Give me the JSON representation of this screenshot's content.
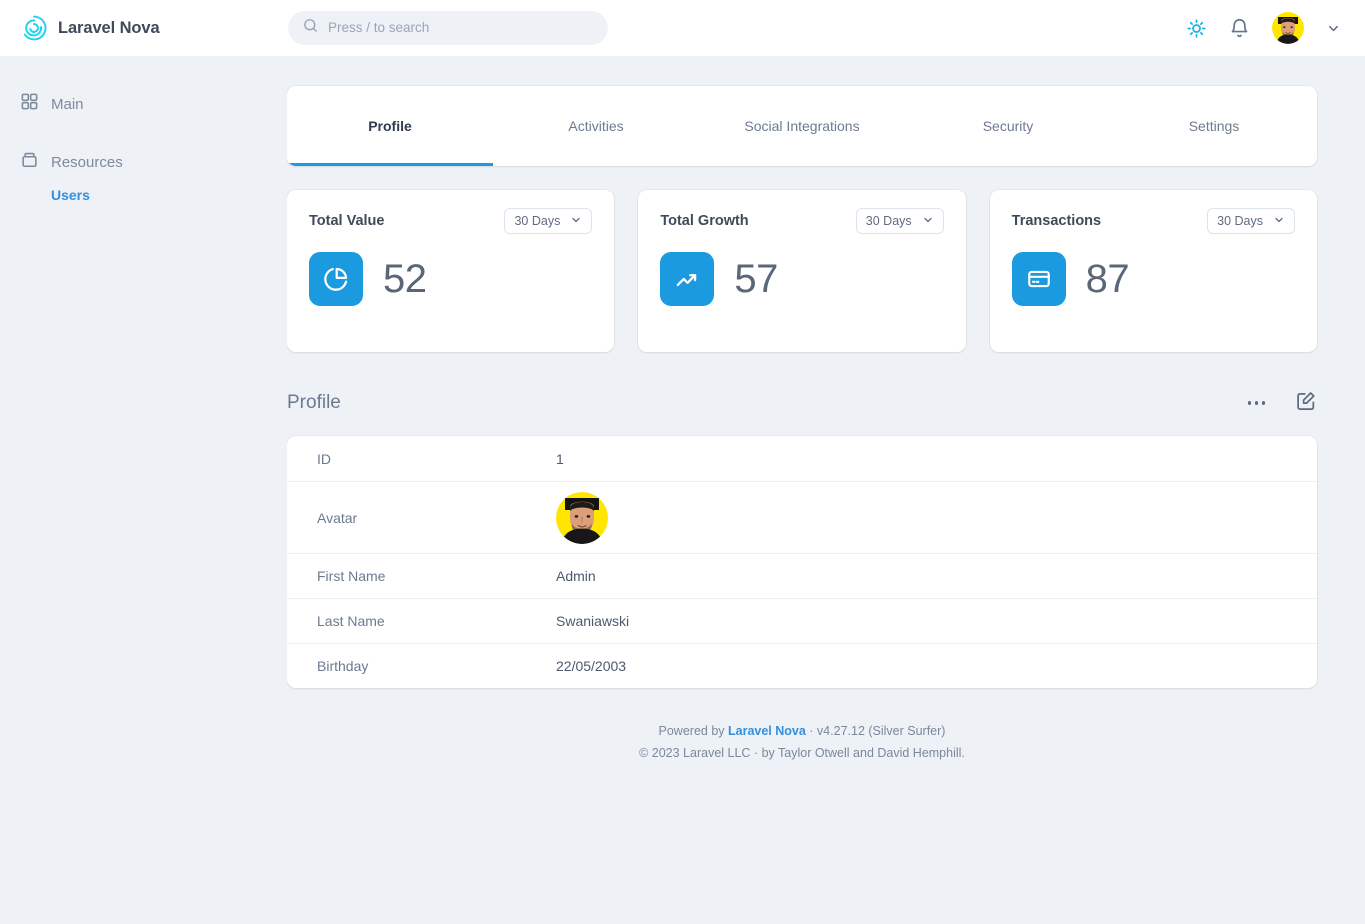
{
  "header": {
    "brand_name": "Laravel Nova",
    "logo_icon": "nova-spiral-logo",
    "search": {
      "placeholder": "Press / to search",
      "value": "",
      "icon": "search-icon"
    },
    "theme_toggle_icon": "sun-icon",
    "notifications_icon": "bell-icon",
    "avatar_icon": "user-avatar",
    "user_menu_icon": "chevron-down-icon"
  },
  "sidebar": {
    "groups": [
      {
        "label": "Main",
        "icon": "grid-icon",
        "items": []
      },
      {
        "label": "Resources",
        "icon": "archive-box-icon",
        "items": [
          {
            "label": "Users",
            "active": true
          }
        ]
      }
    ]
  },
  "tabs": [
    {
      "label": "Profile",
      "active": true
    },
    {
      "label": "Activities",
      "active": false
    },
    {
      "label": "Social Integrations",
      "active": false
    },
    {
      "label": "Security",
      "active": false
    },
    {
      "label": "Settings",
      "active": false
    }
  ],
  "metrics": [
    {
      "title": "Total Value",
      "value": "52",
      "range": "30 Days",
      "icon": "pie-chart-icon"
    },
    {
      "title": "Total Growth",
      "value": "57",
      "range": "30 Days",
      "icon": "trending-up-icon"
    },
    {
      "title": "Transactions",
      "value": "87",
      "range": "30 Days",
      "icon": "credit-card-icon"
    }
  ],
  "panel": {
    "title": "Profile",
    "more_icon": "ellipsis-icon",
    "edit_icon": "edit-pencil-square-icon",
    "rows": [
      {
        "label": "ID",
        "value": "1",
        "type": "text"
      },
      {
        "label": "Avatar",
        "value": "",
        "type": "image"
      },
      {
        "label": "First Name",
        "value": "Admin",
        "type": "text"
      },
      {
        "label": "Last Name",
        "value": "Swaniawski",
        "type": "text"
      },
      {
        "label": "Birthday",
        "value": "22/05/2003",
        "type": "text"
      }
    ]
  },
  "footer": {
    "powered_prefix": "Powered by ",
    "powered_link": "Laravel Nova",
    "powered_suffix": " · v4.27.12 (Silver Surfer)",
    "copyright": "© 2023 Laravel LLC · by Taylor Otwell and David Hemphill."
  },
  "colors": {
    "accent_blue": "#1b9ae0",
    "link_blue": "#3490dc",
    "logo_cyan": "#22d3ee",
    "page_bg": "#eef1f6",
    "avatar_bg": "#ffe600"
  }
}
